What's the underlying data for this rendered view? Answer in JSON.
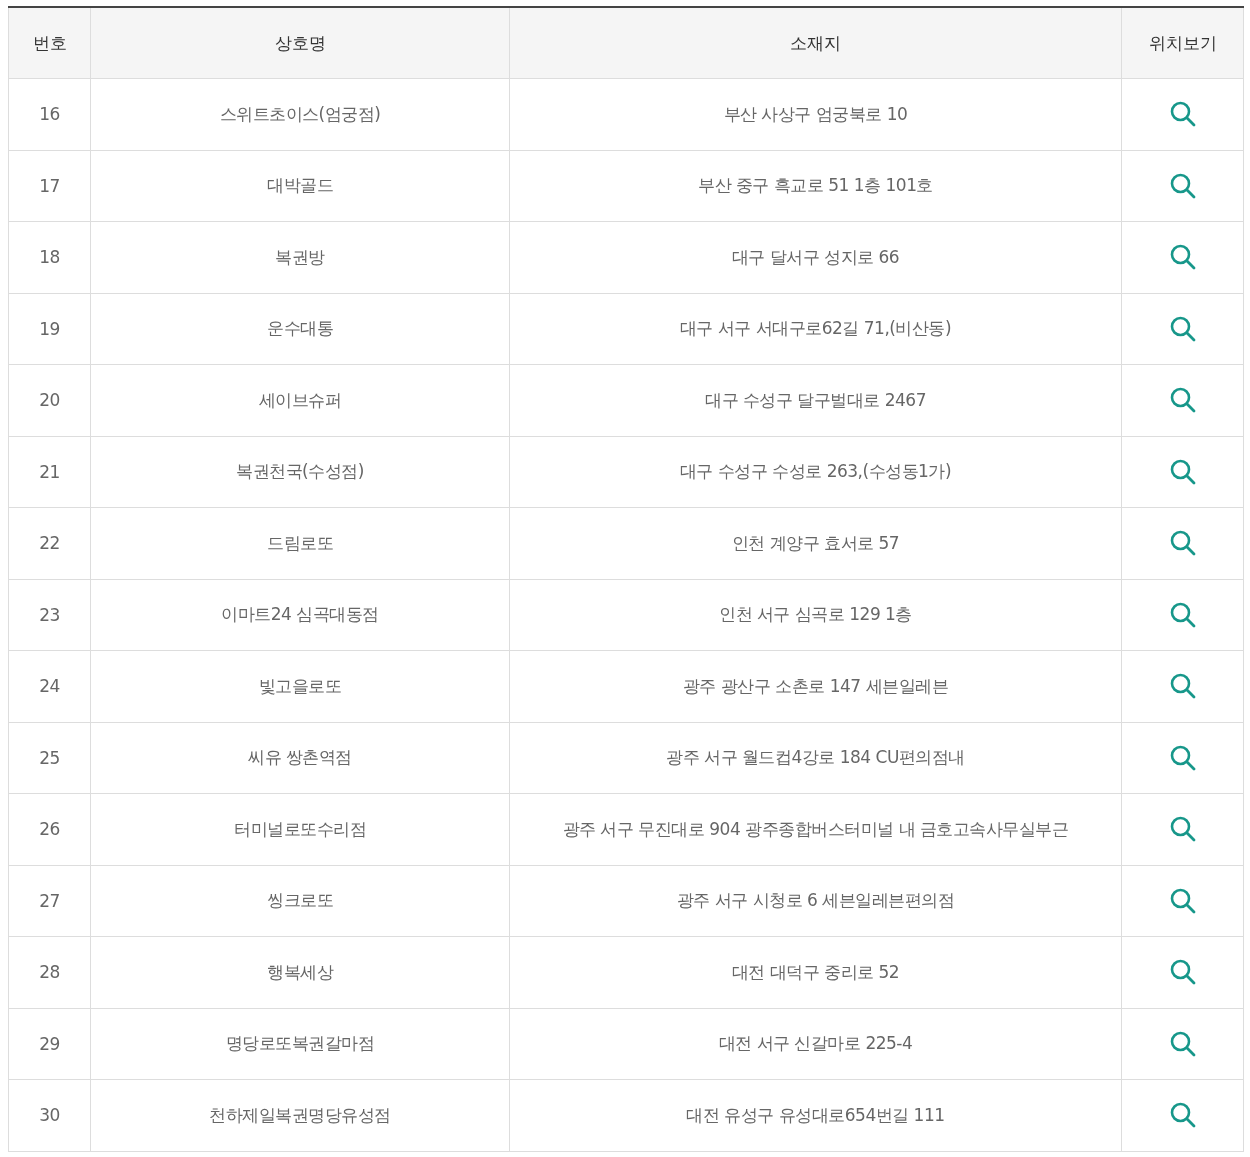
{
  "table": {
    "columns": [
      "번호",
      "상호명",
      "소재지",
      "위치보기"
    ],
    "rows": [
      {
        "number": "16",
        "name": "스위트초이스(엄궁점)",
        "address": "부산 사상구 엄궁북로 10"
      },
      {
        "number": "17",
        "name": "대박골드",
        "address": "부산 중구 흑교로 51 1층 101호"
      },
      {
        "number": "18",
        "name": "복권방",
        "address": "대구 달서구 성지로 66"
      },
      {
        "number": "19",
        "name": "운수대통",
        "address": "대구 서구 서대구로62길 71,(비산동)"
      },
      {
        "number": "20",
        "name": "세이브슈퍼",
        "address": "대구 수성구 달구벌대로 2467"
      },
      {
        "number": "21",
        "name": "복권천국(수성점)",
        "address": "대구 수성구 수성로 263,(수성동1가)"
      },
      {
        "number": "22",
        "name": "드림로또",
        "address": "인천 계양구 효서로 57"
      },
      {
        "number": "23",
        "name": "이마트24 심곡대동점",
        "address": "인천 서구 심곡로 129 1층"
      },
      {
        "number": "24",
        "name": "빛고을로또",
        "address": "광주 광산구 소촌로 147 세븐일레븐"
      },
      {
        "number": "25",
        "name": "씨유 쌍촌역점",
        "address": "광주 서구 월드컵4강로 184 CU편의점내"
      },
      {
        "number": "26",
        "name": "터미널로또수리점",
        "address": "광주 서구 무진대로 904 광주종합버스터미널 내 금호고속사무실부근"
      },
      {
        "number": "27",
        "name": "씽크로또",
        "address": "광주 서구 시청로 6 세븐일레븐편의점"
      },
      {
        "number": "28",
        "name": "행복세상",
        "address": "대전 대덕구 중리로 52"
      },
      {
        "number": "29",
        "name": "명당로또복권갈마점",
        "address": "대전 서구 신갈마로 225-4"
      },
      {
        "number": "30",
        "name": "천하제일복권명당유성점",
        "address": "대전 유성구 유성대로654번길 111"
      }
    ]
  }
}
